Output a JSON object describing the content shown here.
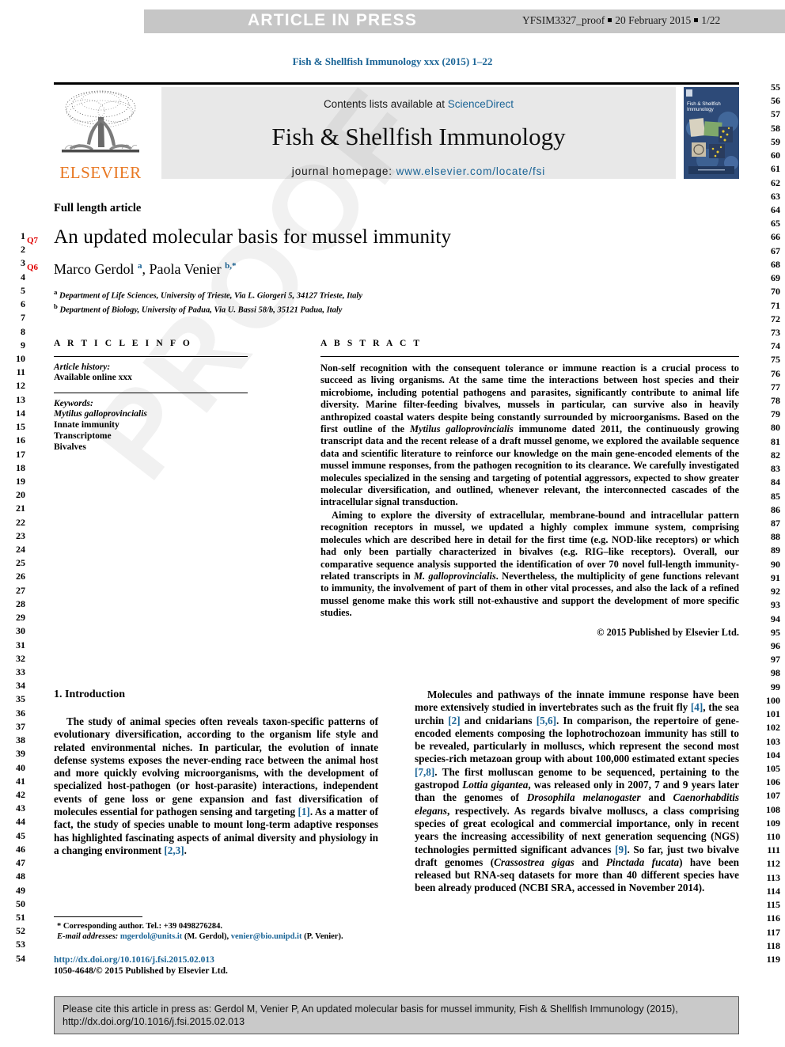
{
  "banner": {
    "label": "ARTICLE IN PRESS",
    "proof_id": "YFSIM3327_proof",
    "proof_date": "20 February 2015",
    "page_count": "1/22"
  },
  "running_head": "Fish & Shellfish Immunology xxx (2015) 1–22",
  "masthead": {
    "contents_prefix": "Contents lists available at ",
    "sciencedirect": "ScienceDirect",
    "journal_title": "Fish & Shellfish Immunology",
    "homepage_prefix": "journal homepage: ",
    "homepage_url": "www.elsevier.com/locate/fsi",
    "publisher": "ELSEVIER",
    "cover_title_line1": "Fish & Shellfish",
    "cover_title_line2": "Immunology"
  },
  "article": {
    "type_label": "Full length article",
    "title": "An updated molecular basis for mussel immunity",
    "authors_part1": "Marco Gerdol ",
    "authors_sup_a": "a",
    "authors_part2": ", Paola Venier ",
    "authors_sup_b": "b,",
    "authors_sup_star": "*",
    "affiliation_a_sup": "a",
    "affiliation_a": " Department of Life Sciences, University of Trieste, Via L. Giorgeri 5, 34127 Trieste, Italy",
    "affiliation_b_sup": "b",
    "affiliation_b": " Department of Biology, University of Padua, Via U. Bassi 58/b, 35121 Padua, Italy"
  },
  "article_info": {
    "heading": "A R T I C L E   I N F O",
    "history_label": "Article history:",
    "history_value": "Available online xxx",
    "keywords_label": "Keywords:",
    "keywords": [
      "Mytilus galloprovincialis",
      "Innate immunity",
      "Transcriptome",
      "Bivalves"
    ]
  },
  "abstract": {
    "heading": "A B S T R A C T",
    "paragraph1": "Non-self recognition with the consequent tolerance or immune reaction is a crucial process to succeed as living organisms. At the same time the interactions between host species and their microbiome, including potential pathogens and parasites, significantly contribute to animal life diversity. Marine filter-feeding bivalves, mussels in particular, can survive also in heavily anthropized coastal waters despite being constantly surrounded by microorganisms. Based on the first outline of the Mytilus galloprovincialis immunome dated 2011, the continuously growing transcript data and the recent release of a draft mussel genome, we explored the available sequence data and scientific literature to reinforce our knowledge on the main gene-encoded elements of the mussel immune responses, from the pathogen recognition to its clearance. We carefully investigated molecules specialized in the sensing and targeting of potential aggressors, expected to show greater molecular diversification, and outlined, whenever relevant, the interconnected cascades of the intracellular signal transduction.",
    "paragraph2": "Aiming to explore the diversity of extracellular, membrane-bound and intracellular pattern recognition receptors in mussel, we updated a highly complex immune system, comprising molecules which are described here in detail for the first time (e.g. NOD-like receptors) or which had only been partially characterized in bivalves (e.g. RIG–like receptors). Overall, our comparative sequence analysis supported the identification of over 70 novel full-length immunity-related transcripts in M. galloprovincialis. Nevertheless, the multiplicity of gene functions relevant to immunity, the involvement of part of them in other vital processes, and also the lack of a refined mussel genome make this work still not-exhaustive and support the development of more specific studies.",
    "copyright": "© 2015 Published by Elsevier Ltd."
  },
  "introduction": {
    "heading": "1. Introduction",
    "left_paragraph": "The study of animal species often reveals taxon-specific patterns of evolutionary diversification, according to the organism life style and related environmental niches. In particular, the evolution of innate defense systems exposes the never-ending race between the animal host and more quickly evolving microorganisms, with the development of specialized host-pathogen (or host-parasite) interactions, independent events of gene loss or gene expansion and fast diversification of molecules essential for pathogen sensing and targeting [1]. As a matter of fact, the study of species unable to mount long-term adaptive responses has highlighted fascinating aspects of animal diversity and physiology in a changing environment [2,3].",
    "right_paragraph": "Molecules and pathways of the innate immune response have been more extensively studied in invertebrates such as the fruit fly [4], the sea urchin [2] and cnidarians [5,6]. In comparison, the repertoire of gene-encoded elements composing the lophotrochozoan immunity has still to be revealed, particularly in molluscs, which represent the second most species-rich metazoan group with about 100,000 estimated extant species [7,8]. The first molluscan genome to be sequenced, pertaining to the gastropod Lottia gigantea, was released only in 2007, 7 and 9 years later than the genomes of Drosophila melanogaster and Caenorhabditis elegans, respectively. As regards bivalve molluscs, a class comprising species of great ecological and commercial importance, only in recent years the increasing accessibility of next generation sequencing (NGS) technologies permitted significant advances [9]. So far, just two bivalve draft genomes (Crassostrea gigas and Pinctada fucata) have been released but RNA-seq datasets for more than 40 different species have been already produced (NCBI SRA, accessed in November 2014)."
  },
  "footnote": {
    "corresponding": "* Corresponding author. Tel.: +39 0498276284.",
    "email_label": "E-mail addresses:",
    "email1": "mgerdol@units.it",
    "email1_who": " (M. Gerdol), ",
    "email2": "venier@bio.unipd.it",
    "email2_who": " (P. Venier)."
  },
  "doi_block": {
    "doi_url": "http://dx.doi.org/10.1016/j.fsi.2015.02.013",
    "issn_line": "1050-4648/© 2015 Published by Elsevier Ltd."
  },
  "citation_box": {
    "line1": "Please cite this article in press as: Gerdol M, Venier P, An updated molecular basis for mussel immunity, Fish & Shellfish Immunology (2015),",
    "line2": "http://dx.doi.org/10.1016/j.fsi.2015.02.013"
  },
  "watermark": "PROOF",
  "gutters": {
    "left_start": 1,
    "left_end": 54,
    "right_start": 55,
    "right_end": 119,
    "query_marks": [
      "Q7",
      "Q6"
    ]
  },
  "colors": {
    "link": "#1a6496",
    "elsevier_orange": "#E87722",
    "banner_gray": "#c6c6c6",
    "masthead_gray": "#e8e8e8",
    "query_red": "#e00000"
  }
}
